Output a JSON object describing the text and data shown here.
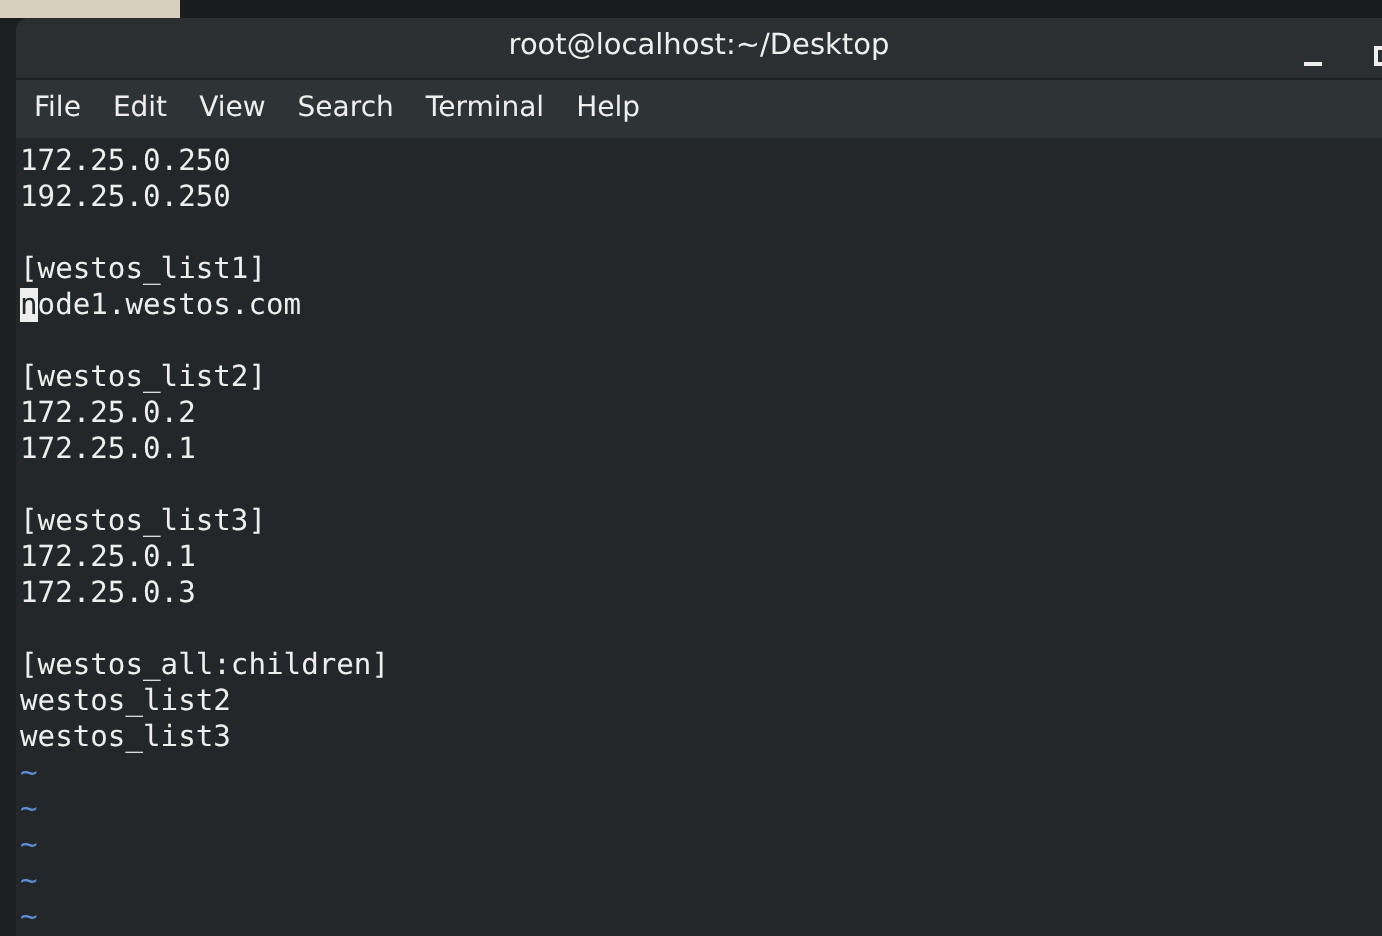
{
  "window": {
    "title": "root@localhost:~/Desktop"
  },
  "menu": [
    "File",
    "Edit",
    "View",
    "Search",
    "Terminal",
    "Help"
  ],
  "lines": [
    {
      "kind": "text",
      "text": "172.25.0.250",
      "cursor": false
    },
    {
      "kind": "text",
      "text": "192.25.0.250",
      "cursor": false
    },
    {
      "kind": "blank"
    },
    {
      "kind": "text",
      "text": "[westos_list1]",
      "cursor": false
    },
    {
      "kind": "text",
      "text": "node1.westos.com",
      "cursor": true
    },
    {
      "kind": "blank"
    },
    {
      "kind": "text",
      "text": "[westos_list2]",
      "cursor": false
    },
    {
      "kind": "text",
      "text": "172.25.0.2",
      "cursor": false
    },
    {
      "kind": "text",
      "text": "172.25.0.1",
      "cursor": false
    },
    {
      "kind": "blank"
    },
    {
      "kind": "text",
      "text": "[westos_list3]",
      "cursor": false
    },
    {
      "kind": "text",
      "text": "172.25.0.1",
      "cursor": false
    },
    {
      "kind": "text",
      "text": "172.25.0.3",
      "cursor": false
    },
    {
      "kind": "blank"
    },
    {
      "kind": "text",
      "text": "[westos_all:children]",
      "cursor": false
    },
    {
      "kind": "text",
      "text": "westos_list2",
      "cursor": false
    },
    {
      "kind": "text",
      "text": "westos_list3",
      "cursor": false
    },
    {
      "kind": "tilde",
      "text": "~"
    },
    {
      "kind": "tilde",
      "text": "~"
    },
    {
      "kind": "tilde",
      "text": "~"
    },
    {
      "kind": "tilde",
      "text": "~"
    },
    {
      "kind": "tilde",
      "text": "~"
    }
  ]
}
